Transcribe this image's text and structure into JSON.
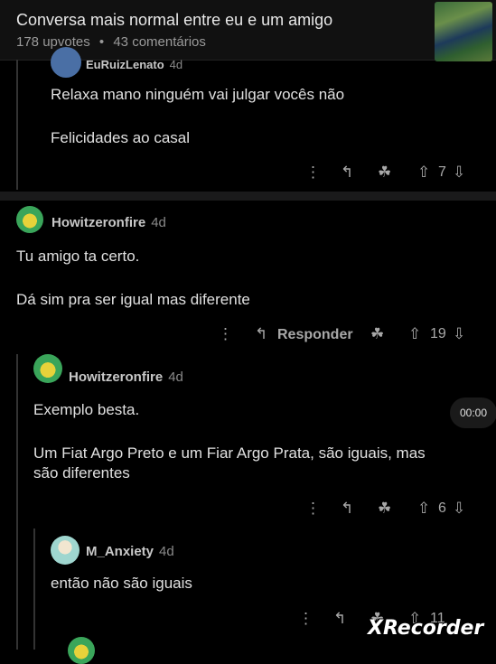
{
  "post": {
    "title": "Conversa mais normal entre eu e um amigo",
    "upvotes": "178 upvotes",
    "separator": "•",
    "comments": "43 comentários"
  },
  "comments": [
    {
      "user": "EuRuizLenato",
      "age": "4d",
      "lines": [
        "Relaxa mano ninguém vai julgar vocês não",
        "Felicidades ao casal"
      ],
      "score": "7"
    },
    {
      "user": "Howitzeronfire",
      "age": "4d",
      "lines": [
        "Tu amigo ta certo.",
        "Dá sim pra ser igual mas diferente"
      ],
      "reply_label": "Responder",
      "score": "19"
    },
    {
      "user": "Howitzeronfire",
      "age": "4d",
      "lines": [
        "Exemplo besta.",
        "Um Fiat Argo Preto e um Fiar Argo Prata, são iguais, mas",
        "são diferentes"
      ],
      "score": "6"
    },
    {
      "user": "M_Anxiety",
      "age": "4d",
      "lines": [
        "então não são iguais"
      ],
      "score": "11"
    }
  ],
  "icons": {
    "more": "⋮",
    "reply": "↰",
    "award": "☘",
    "upvote": "⇧",
    "downvote": "⇩"
  },
  "recording": {
    "timer": "00:00",
    "watermark": "XRecorder"
  }
}
